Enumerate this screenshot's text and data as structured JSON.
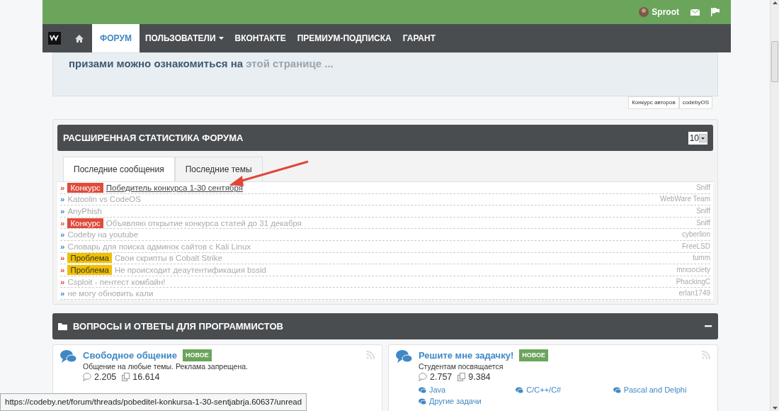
{
  "top_bar": {
    "username": "Sproot"
  },
  "nav": {
    "items": [
      {
        "label": "ФОРУМ",
        "selected": true,
        "dropdown": false
      },
      {
        "label": "ПОЛЬЗОВАТЕЛИ",
        "selected": false,
        "dropdown": true
      },
      {
        "label": "ВКОНТАКТЕ",
        "selected": false,
        "dropdown": false
      },
      {
        "label": "ПРЕМИУМ-ПОДПИСКА",
        "selected": false,
        "dropdown": false
      },
      {
        "label": "ГАРАНТ",
        "selected": false,
        "dropdown": false
      }
    ]
  },
  "notice": {
    "text": "призами можно ознакомиться на",
    "link": "этой странице ..."
  },
  "notice_tabs": [
    "Конкурс авторов",
    "codebyOS"
  ],
  "stats": {
    "title": "РАСШИРЕННАЯ СТАТИСТИКА ФОРУМА",
    "count": "10",
    "tabs": [
      {
        "label": "Последние сообщения",
        "selected": true
      },
      {
        "label": "Последние темы",
        "selected": false
      }
    ],
    "rows": [
      {
        "marker": "»",
        "color": "#e04a3a",
        "tag": {
          "label": "Конкурс",
          "kind": "contest"
        },
        "title": "Победитель конкурса 1-30 сентября",
        "hovered": true,
        "author": "Sniff"
      },
      {
        "marker": "»",
        "color": "#3f88c5",
        "title": "Katoolin vs CodeOS",
        "hovered": false,
        "author": "WebWare Team"
      },
      {
        "marker": "»",
        "color": "#3f88c5",
        "title": "AnyPhish",
        "hovered": false,
        "author": "Sniff"
      },
      {
        "marker": "»",
        "color": "#e04a3a",
        "tag": {
          "label": "Конкурс",
          "kind": "contest"
        },
        "title": "Объявляю открытие конкурса статей до 31 декабря",
        "hovered": false,
        "author": "Sniff"
      },
      {
        "marker": "»",
        "color": "#3f88c5",
        "title": "Codeby на youtube",
        "hovered": false,
        "author": "cyberlion"
      },
      {
        "marker": "»",
        "color": "#3f88c5",
        "title": "Словарь для поиска админок сайтов с Kali Linux",
        "hovered": false,
        "author": "FreeLSD"
      },
      {
        "marker": "»",
        "color": "#e04a3a",
        "tag": {
          "label": "Проблема",
          "kind": "problem"
        },
        "title": "Свои скрипты в Cobalt Strike",
        "hovered": false,
        "author": "tumm"
      },
      {
        "marker": "»",
        "color": "#e04a3a",
        "tag": {
          "label": "Проблема",
          "kind": "problem"
        },
        "title": "Не происходит деаутентификация bssid",
        "hovered": false,
        "author": "mrxsociety"
      },
      {
        "marker": "»",
        "color": "#e04a3a",
        "title": "Csploit - пентест комбайн!",
        "hovered": false,
        "author": "PhackingC"
      },
      {
        "marker": "»",
        "color": "#3f88c5",
        "title": "не могу обновить кали",
        "hovered": false,
        "author": "erlan1749"
      }
    ]
  },
  "category": {
    "title": "ВОПРОСЫ И ОТВЕТЫ ДЛЯ ПРОГРАММИСТОВ",
    "collapse": "−",
    "forums": [
      {
        "title": "Свободное общение",
        "badge": "НОВОЕ",
        "description": "Общение на любые темы. Реклама запрещена.",
        "threads": "2.205",
        "messages": "16.614"
      },
      {
        "title": "Решите мне задачку!",
        "badge": "НОВОЕ",
        "description": "Студентам посвящается",
        "threads": "2.757",
        "messages": "9.384",
        "subforums": [
          "Java",
          "C/C++/C#",
          "Pascal and Delphi",
          "Другие задачи"
        ]
      }
    ]
  },
  "status_url": "https://codeby.net/forum/threads/pobeditel-konkursa-1-30-sentjabrja.60637/unread"
}
